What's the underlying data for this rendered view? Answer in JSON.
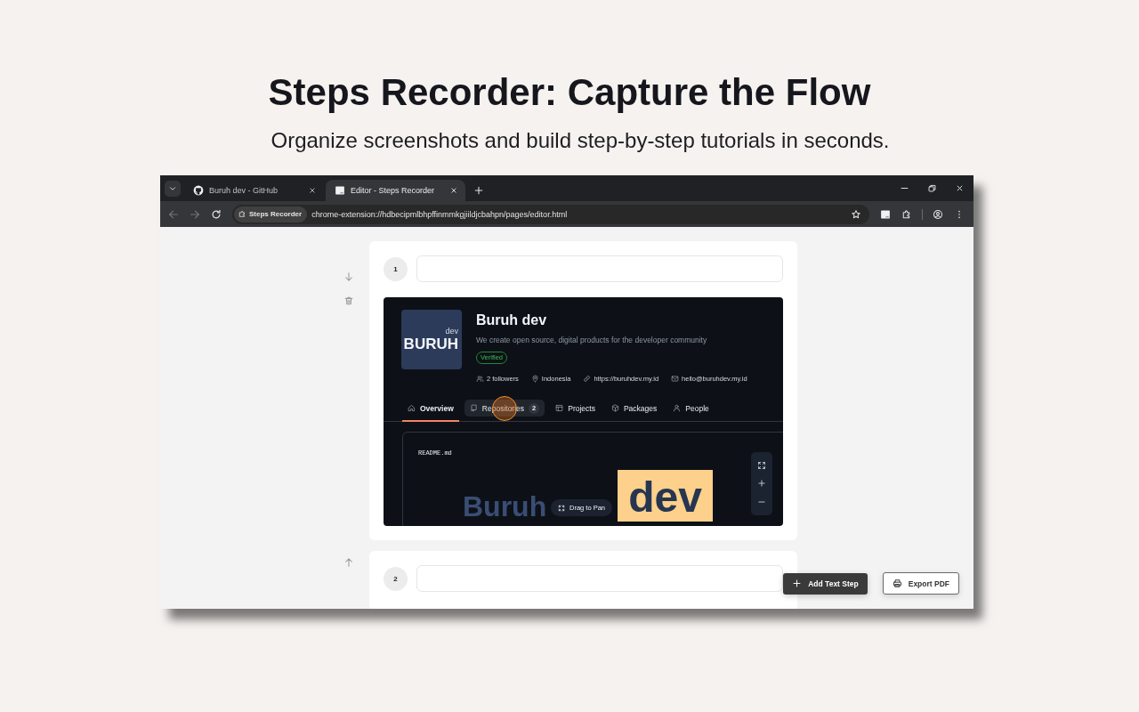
{
  "heading": {
    "title": "Steps Recorder: Capture the Flow",
    "subtitle": "Organize screenshots and build step-by-step tutorials in seconds."
  },
  "browser": {
    "tabs": [
      {
        "kind": "github",
        "title": "Buruh dev - GitHub",
        "selected": false
      },
      {
        "kind": "page",
        "title": "Editor - Steps Recorder",
        "selected": true
      }
    ],
    "nav_buttons": [
      {
        "kind": "back",
        "disabled": true
      },
      {
        "kind": "forward",
        "disabled": true
      },
      {
        "kind": "reload",
        "disabled": false
      }
    ],
    "site_chip": "Steps Recorder",
    "url": "chrome-extension://hdbecipmlbhpffinmmkgjiildjcbahpn/pages/editor.html"
  },
  "steps": [
    {
      "number": "1",
      "controls": [
        {
          "kind": "move_down"
        },
        {
          "kind": "delete"
        }
      ],
      "screenshot": {
        "avatar": {
          "small": "dev",
          "large": "BURUH"
        },
        "name": "Buruh dev",
        "description": "We create open source, digital products for the developer community",
        "badge": "Verified",
        "meta": [
          {
            "kind": "followers",
            "text": "2 followers"
          },
          {
            "kind": "location",
            "text": "Indonesia"
          },
          {
            "kind": "link",
            "text": "https://buruhdev.my.id"
          },
          {
            "kind": "email",
            "text": "hello@buruhdev.my.id"
          }
        ],
        "tabs": [
          {
            "kind": "overview",
            "label": "Overview",
            "selected": true,
            "hovered": false,
            "clicked": false
          },
          {
            "kind": "repositories",
            "label": "Repositories",
            "counter": "2",
            "selected": false,
            "hovered": true,
            "clicked": true
          },
          {
            "kind": "projects",
            "label": "Projects",
            "selected": false,
            "hovered": false,
            "clicked": false
          },
          {
            "kind": "packages",
            "label": "Packages",
            "selected": false,
            "hovered": false,
            "clicked": false
          },
          {
            "kind": "people",
            "label": "People",
            "selected": false,
            "hovered": false,
            "clicked": false
          }
        ],
        "readme": {
          "file": "README.md",
          "logo": [
            {
              "text": "Buruh",
              "boxed": false
            },
            {
              "text": "dev",
              "boxed": true
            }
          ]
        },
        "pan_hint": "Drag to Pan",
        "zoom_controls": [
          {
            "kind": "fit"
          },
          {
            "kind": "zoom_in"
          },
          {
            "kind": "zoom_out"
          }
        ]
      }
    },
    {
      "number": "2",
      "controls": [
        {
          "kind": "move_up"
        }
      ]
    }
  ],
  "actions": [
    {
      "kind": "add",
      "label": "Add Text Step"
    },
    {
      "kind": "print",
      "label": "Export PDF"
    }
  ]
}
